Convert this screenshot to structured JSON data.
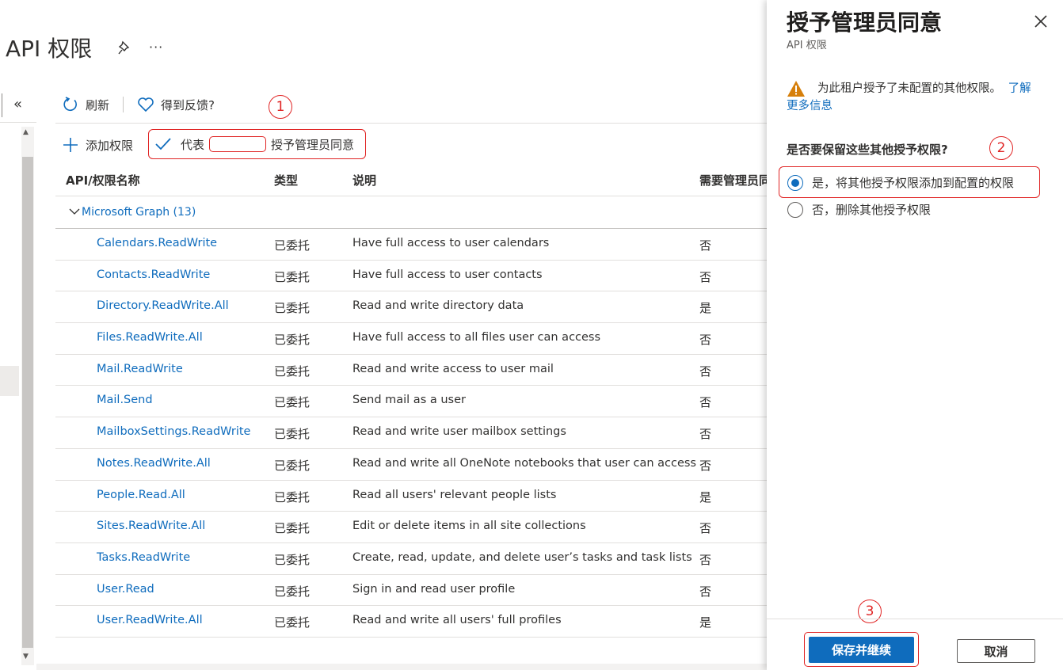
{
  "page": {
    "title": "API 权限",
    "more": "···"
  },
  "toolbar": {
    "refresh_label": "刷新",
    "feedback_label": "得到反馈?",
    "add_permission_label": "添加权限",
    "grant_consent_prefix": "代表",
    "grant_consent_suffix": "授予管理员同意"
  },
  "annotations": [
    "1",
    "2",
    "3"
  ],
  "table": {
    "headers": [
      "API/权限名称",
      "类型",
      "说明",
      "需要管理员同"
    ],
    "group": "Microsoft Graph (13)",
    "rows": [
      {
        "name": "Calendars.ReadWrite",
        "type": "已委托",
        "desc": "Have full access to user calendars",
        "admin": "否"
      },
      {
        "name": "Contacts.ReadWrite",
        "type": "已委托",
        "desc": "Have full access to user contacts",
        "admin": "否"
      },
      {
        "name": "Directory.ReadWrite.All",
        "type": "已委托",
        "desc": "Read and write directory data",
        "admin": "是"
      },
      {
        "name": "Files.ReadWrite.All",
        "type": "已委托",
        "desc": "Have full access to all files user can access",
        "admin": "否"
      },
      {
        "name": "Mail.ReadWrite",
        "type": "已委托",
        "desc": "Read and write access to user mail",
        "admin": "否"
      },
      {
        "name": "Mail.Send",
        "type": "已委托",
        "desc": "Send mail as a user",
        "admin": "否"
      },
      {
        "name": "MailboxSettings.ReadWrite",
        "type": "已委托",
        "desc": "Read and write user mailbox settings",
        "admin": "否"
      },
      {
        "name": "Notes.ReadWrite.All",
        "type": "已委托",
        "desc": "Read and write all OneNote notebooks that user can access",
        "admin": "否"
      },
      {
        "name": "People.Read.All",
        "type": "已委托",
        "desc": "Read all users' relevant people lists",
        "admin": "是"
      },
      {
        "name": "Sites.ReadWrite.All",
        "type": "已委托",
        "desc": "Edit or delete items in all site collections",
        "admin": "否"
      },
      {
        "name": "Tasks.ReadWrite",
        "type": "已委托",
        "desc": "Create, read, update, and delete user’s tasks and task lists",
        "admin": "否"
      },
      {
        "name": "User.Read",
        "type": "已委托",
        "desc": "Sign in and read user profile",
        "admin": "否"
      },
      {
        "name": "User.ReadWrite.All",
        "type": "已委托",
        "desc": "Read and write all users' full profiles",
        "admin": "是"
      }
    ]
  },
  "panel": {
    "title": "授予管理员同意",
    "subtitle": "API 权限",
    "warning_text": "为此租户授予了未配置的其他权限。",
    "warning_link_part1": "了解",
    "warning_link_part2": "更多信息",
    "question": "是否要保留这些其他授予权限?",
    "option_yes": "是，将其他授予权限添加到配置的权限",
    "option_no": "否，删除其他授予权限",
    "selected_option": "yes",
    "save_label": "保存并继续",
    "cancel_label": "取消"
  },
  "colors": {
    "link": "#0f6cbd",
    "primary": "#0f6cbd",
    "annotation": "#e02424",
    "warning": "#d67f0b"
  }
}
